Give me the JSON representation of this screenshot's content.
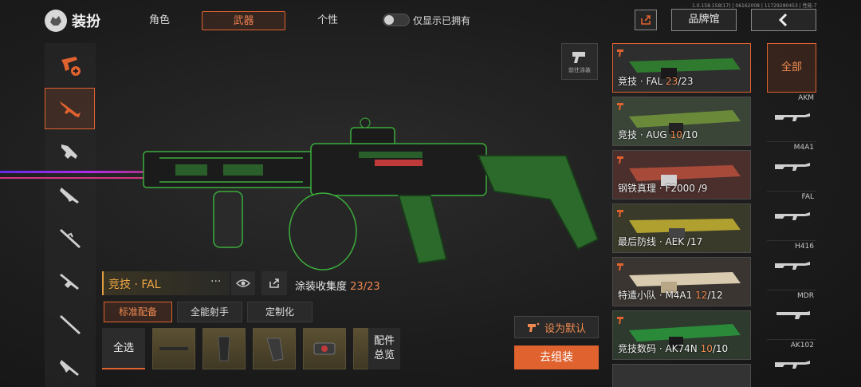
{
  "header": {
    "title": "装扮",
    "tabs": [
      "角色",
      "武器",
      "个性"
    ],
    "active_tab": "武器",
    "toggle_label": "仅显示已拥有",
    "build_info": "1.0.158.158(17) | 06162008 | 11729280453 | 性能-7",
    "brand_label": "品牌馆"
  },
  "paint": {
    "label": "前往涂装"
  },
  "weapon": {
    "name": "竞技 · FAL",
    "more": "···",
    "collect_label": "涂装收集度",
    "collect_value": "23/23"
  },
  "loadout_tabs": [
    "标准配备",
    "全能射手",
    "定制化"
  ],
  "attachments": {
    "select_all": "全选",
    "overview_line1": "配件",
    "overview_line2": "总览"
  },
  "actions": {
    "set_default": "设为默认",
    "assemble": "去组装"
  },
  "skins": [
    {
      "name": "竞技 · FAL ",
      "owned": "23",
      "total": "/23"
    },
    {
      "name": "竞技 · AUG ",
      "owned": "10",
      "total": "/10"
    },
    {
      "name": "钢铁真理 · F2000 ",
      "owned": "",
      "total": "/9"
    },
    {
      "name": "最后防线 · AEK ",
      "owned": "",
      "total": "/17"
    },
    {
      "name": "特遣小队 · M4A1 ",
      "owned": "12",
      "total": "/12"
    },
    {
      "name": "竞技数码 · AK74N ",
      "owned": "10",
      "total": "/10"
    }
  ],
  "types": {
    "all": "全部",
    "items": [
      "AKM",
      "M4A1",
      "FAL",
      "H416",
      "MDR",
      "AK102"
    ]
  },
  "colors": {
    "accent": "#e0622f",
    "highlight": "#f08a50",
    "gold": "#f0a845"
  }
}
